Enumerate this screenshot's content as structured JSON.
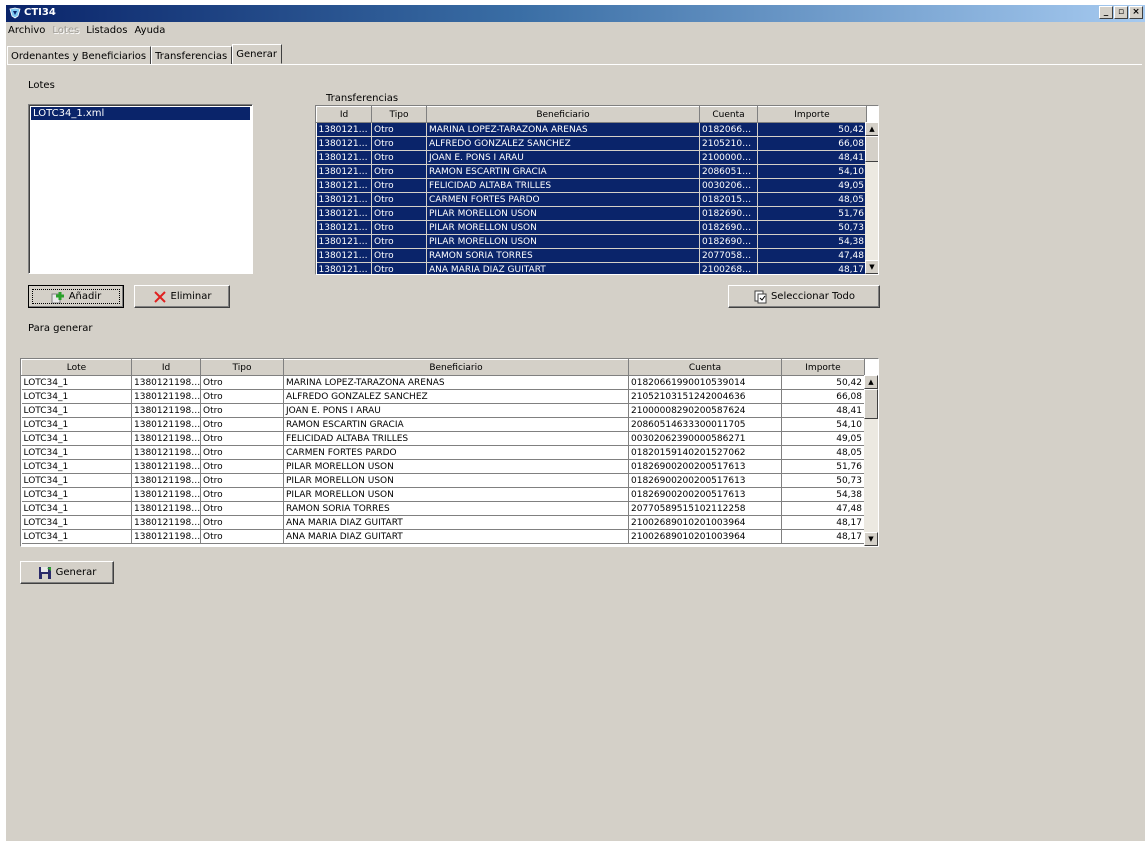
{
  "window": {
    "title": "CTI34",
    "buttons": {
      "minimize": "_",
      "maximize": "▫",
      "close": "×"
    }
  },
  "menu": [
    {
      "label": "Archivo",
      "enabled": true
    },
    {
      "label": "Lotes",
      "enabled": false
    },
    {
      "label": "Listados",
      "enabled": true
    },
    {
      "label": "Ayuda",
      "enabled": true
    }
  ],
  "tabs": [
    {
      "label": "Ordenantes y Beneficiarios",
      "active": false
    },
    {
      "label": "Transferencias",
      "active": false
    },
    {
      "label": "Generar",
      "active": true
    }
  ],
  "lotes": {
    "label": "Lotes",
    "items": [
      "LOTC34_1.xml"
    ],
    "add_label": "Añadir",
    "remove_label": "Eliminar"
  },
  "transferencias": {
    "label": "Transferencias",
    "columns": [
      "Id",
      "Tipo",
      "Beneficiario",
      "Cuenta",
      "Importe"
    ],
    "rows": [
      [
        "1380121…",
        "Otro",
        "MARINA LOPEZ-TARAZONA ARENAS",
        "0182066…",
        "50,42"
      ],
      [
        "1380121…",
        "Otro",
        "ALFREDO GONZALEZ SANCHEZ",
        "2105210…",
        "66,08"
      ],
      [
        "1380121…",
        "Otro",
        "JOAN E. PONS I ARAU",
        "2100000…",
        "48,41"
      ],
      [
        "1380121…",
        "Otro",
        "RAMON ESCARTIN GRACIA",
        "2086051…",
        "54,10"
      ],
      [
        "1380121…",
        "Otro",
        "FELICIDAD ALTABA TRILLES",
        "0030206…",
        "49,05"
      ],
      [
        "1380121…",
        "Otro",
        "CARMEN FORTES PARDO",
        "0182015…",
        "48,05"
      ],
      [
        "1380121…",
        "Otro",
        "PILAR MORELLON USON",
        "0182690…",
        "51,76"
      ],
      [
        "1380121…",
        "Otro",
        "PILAR MORELLON USON",
        "0182690…",
        "50,73"
      ],
      [
        "1380121…",
        "Otro",
        "PILAR MORELLON USON",
        "0182690…",
        "54,38"
      ],
      [
        "1380121…",
        "Otro",
        "RAMON SORIA TORRES",
        "2077058…",
        "47,48"
      ],
      [
        "1380121…",
        "Otro",
        "ANA MARIA DIAZ GUITART",
        "2100268…",
        "48,17"
      ]
    ],
    "select_all_label": "Seleccionar Todo"
  },
  "para_generar": {
    "label": "Para generar",
    "columns": [
      "Lote",
      "Id",
      "Tipo",
      "Beneficiario",
      "Cuenta",
      "Importe"
    ],
    "rows": [
      [
        "LOTC34_1",
        "1380121198…",
        "Otro",
        "MARINA LOPEZ-TARAZONA ARENAS",
        "01820661990010539014",
        "50,42"
      ],
      [
        "LOTC34_1",
        "1380121198…",
        "Otro",
        "ALFREDO GONZALEZ SANCHEZ",
        "21052103151242004636",
        "66,08"
      ],
      [
        "LOTC34_1",
        "1380121198…",
        "Otro",
        "JOAN E. PONS I ARAU",
        "21000008290200587624",
        "48,41"
      ],
      [
        "LOTC34_1",
        "1380121198…",
        "Otro",
        "RAMON ESCARTIN GRACIA",
        "20860514633300011705",
        "54,10"
      ],
      [
        "LOTC34_1",
        "1380121198…",
        "Otro",
        "FELICIDAD ALTABA TRILLES",
        "00302062390000586271",
        "49,05"
      ],
      [
        "LOTC34_1",
        "1380121198…",
        "Otro",
        "CARMEN FORTES PARDO",
        "01820159140201527062",
        "48,05"
      ],
      [
        "LOTC34_1",
        "1380121198…",
        "Otro",
        "PILAR MORELLON USON",
        "01826900200200517613",
        "51,76"
      ],
      [
        "LOTC34_1",
        "1380121198…",
        "Otro",
        "PILAR MORELLON USON",
        "01826900200200517613",
        "50,73"
      ],
      [
        "LOTC34_1",
        "1380121198…",
        "Otro",
        "PILAR MORELLON USON",
        "01826900200200517613",
        "54,38"
      ],
      [
        "LOTC34_1",
        "1380121198…",
        "Otro",
        "RAMON SORIA TORRES",
        "20770589515102112258",
        "47,48"
      ],
      [
        "LOTC34_1",
        "1380121198…",
        "Otro",
        "ANA MARIA DIAZ GUITART",
        "21002689010201003964",
        "48,17"
      ],
      [
        "LOTC34_1",
        "1380121198…",
        "Otro",
        "ANA MARIA DIAZ GUITART",
        "21002689010201003964",
        "48,17"
      ]
    ],
    "generate_label": "Generar"
  },
  "colors": {
    "face": "#d4d0c8",
    "selection": "#0a246a",
    "title_gradient_start": "#0a246a",
    "title_gradient_end": "#a6caf0"
  },
  "icons": {
    "app": "app-logo-icon",
    "add": "add-plus-icon",
    "remove": "red-x-icon",
    "select_all": "select-all-icon",
    "generate": "floppy-save-icon"
  }
}
